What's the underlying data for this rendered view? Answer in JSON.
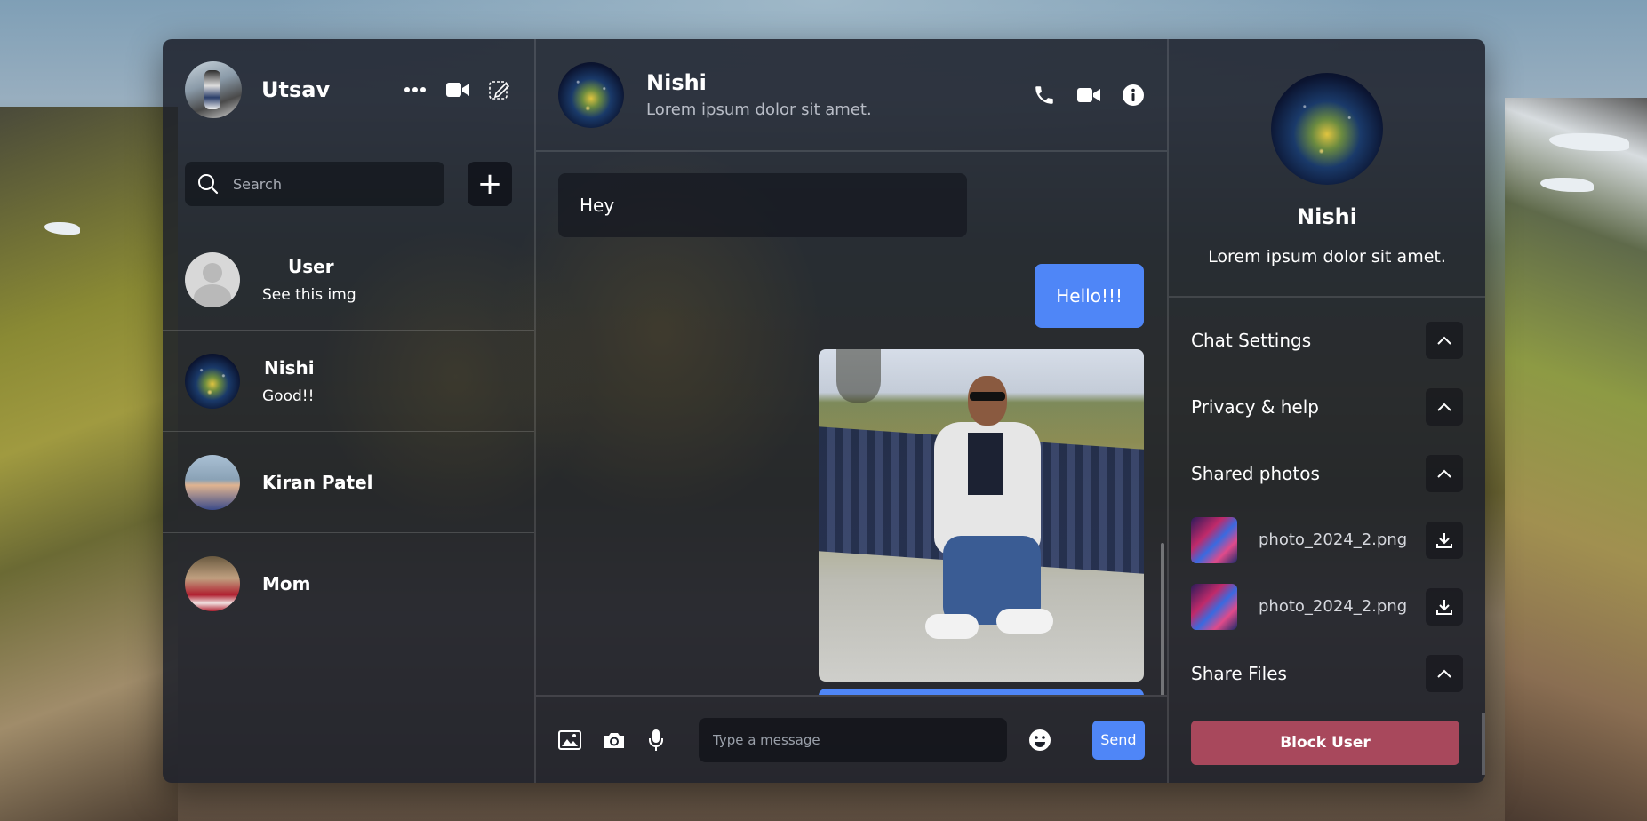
{
  "me": {
    "name": "Utsav"
  },
  "search": {
    "placeholder": "Search"
  },
  "add_label": "+",
  "chats": [
    {
      "name": "User",
      "last": "See this img"
    },
    {
      "name": "Nishi",
      "last": "Good!!"
    },
    {
      "name": "Kiran Patel",
      "last": ""
    },
    {
      "name": "Mom",
      "last": ""
    }
  ],
  "active_chat": {
    "name": "Nishi",
    "status": "Lorem ipsum dolor sit amet."
  },
  "messages": {
    "incoming": "Hey",
    "outgoing": "Hello!!!"
  },
  "composer": {
    "placeholder": "Type a message",
    "send_label": "Send"
  },
  "details": {
    "name": "Nishi",
    "status": "Lorem ipsum dolor sit amet.",
    "sections": {
      "chat_settings": "Chat Settings",
      "privacy": "Privacy & help",
      "shared_photos": "Shared photos",
      "share_files": "Share Files"
    },
    "photos": [
      "photo_2024_2.png",
      "photo_2024_2.png"
    ],
    "block_label": "Block User"
  },
  "colors": {
    "accent": "#4f86f7",
    "danger": "#a8485c"
  },
  "icons": {
    "left_header": [
      "more-icon",
      "video-icon",
      "edit-icon"
    ],
    "chat_header": [
      "phone-icon",
      "video-icon",
      "info-icon"
    ],
    "composer": [
      "image-icon",
      "camera-icon",
      "mic-icon",
      "emoji-icon"
    ]
  }
}
